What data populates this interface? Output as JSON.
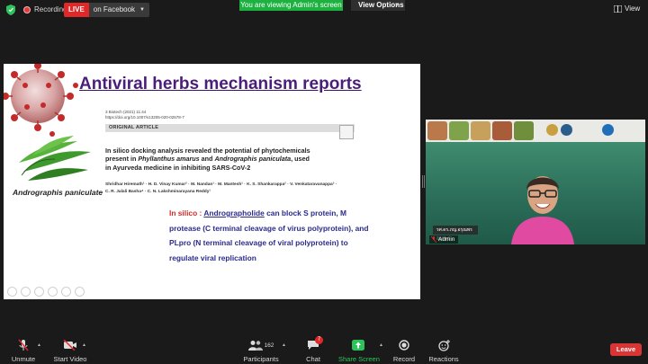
{
  "topbar": {
    "recording_label": "Recording",
    "live_badge": "LIVE",
    "live_destination": "on Facebook",
    "viewing_banner": "You are viewing Admin's screen",
    "view_options_label": "View Options",
    "view_label": "View"
  },
  "slide": {
    "title": "Antiviral herbs mechanism reports",
    "journal_line1": "3 Biotech (2021) 11:44",
    "journal_line2": "https://doi.org/10.1007/s13205-020-02578-7",
    "article_type": "ORIGINAL ARTICLE",
    "paper_title_1": "In silico docking analysis revealed the potential of phytochemicals",
    "paper_title_2a": "present in ",
    "paper_title_2b": "Phyllanthus amarus",
    "paper_title_2c": " and ",
    "paper_title_2d": "Andrographis paniculata",
    "paper_title_2e": ", used",
    "paper_title_3": "in Ayurveda medicine in inhibiting SARS-CoV-2",
    "authors_1": "Shridhar Hiremath¹ · H. D. Vinay Kumar² · M. Nandan¹ · M. Mantesh¹ · K. S. Shankarappa² · V. Venkataravanappa³ ·",
    "authors_2": "C. R. Jalali Basha⁴ · C. N. Lakshminarayana Reddy¹",
    "herb_label": "Andrographis paniculate",
    "highlight_red": "In silico : ",
    "highlight_compound": "Andrographolide",
    "highlight_line1_rest": " can block S protein, M",
    "highlight_line2": "protease (C terminal cleavage of virus polyprotein), and",
    "highlight_line3": "PLpro (N terminal cleavage of viral polyprotein) to",
    "highlight_line4": "regulate viral replication"
  },
  "video": {
    "name_card": "รศ.ดร.ภญ.อรุณพร อิฐรัตน์",
    "participant_name": "Admin"
  },
  "toolbar": {
    "unmute_label": "Unmute",
    "start_video_label": "Start Video",
    "participants_label": "Participants",
    "participants_count": "162",
    "chat_label": "Chat",
    "chat_badge": "7",
    "share_screen_label": "Share Screen",
    "record_label": "Record",
    "reactions_label": "Reactions",
    "leave_label": "Leave"
  },
  "colors": {
    "live_red": "#e02828",
    "viewing_green": "#1db240",
    "share_green": "#2ec35a",
    "title_purple": "#4b1d7a",
    "highlight_blue": "#2b2b8c",
    "highlight_red": "#d22a2a",
    "leave_red": "#d93535"
  }
}
